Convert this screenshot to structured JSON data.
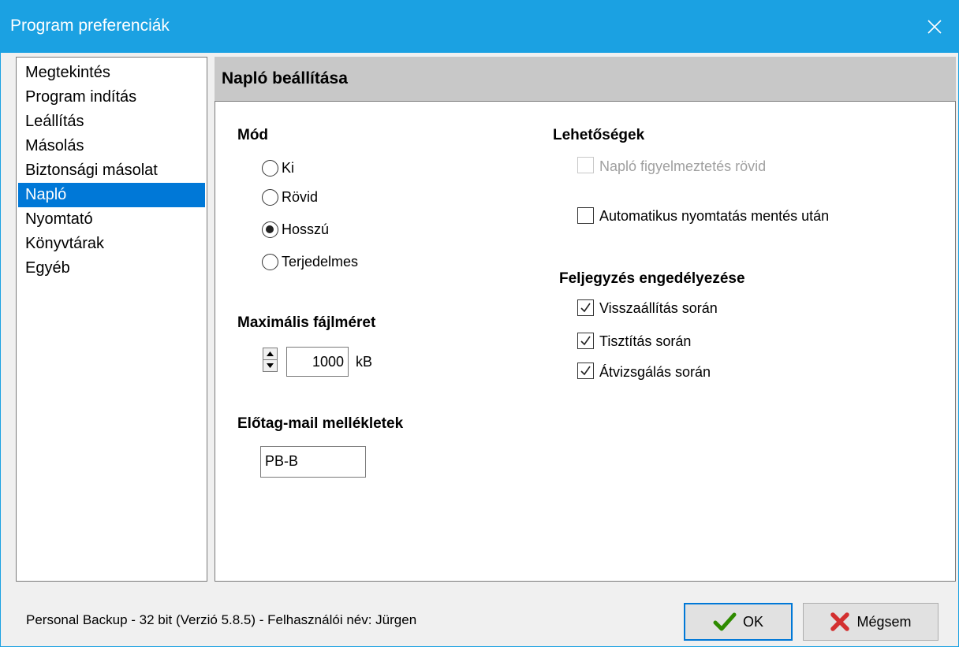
{
  "window": {
    "title": "Program preferenciák"
  },
  "nav": {
    "items": [
      {
        "label": "Megtekintés"
      },
      {
        "label": "Program indítás"
      },
      {
        "label": "Leállítás"
      },
      {
        "label": "Másolás"
      },
      {
        "label": "Biztonsági másolat"
      },
      {
        "label": "Napló"
      },
      {
        "label": "Nyomtató"
      },
      {
        "label": "Könyvtárak"
      },
      {
        "label": "Egyéb"
      }
    ],
    "selected": "Napló"
  },
  "section": {
    "title": "Napló beállítása"
  },
  "mode": {
    "title": "Mód",
    "options": [
      {
        "label": "Ki",
        "selected": false
      },
      {
        "label": "Rövid",
        "selected": false
      },
      {
        "label": "Hosszú",
        "selected": true
      },
      {
        "label": "Terjedelmes",
        "selected": false
      }
    ]
  },
  "max_size": {
    "title": "Maximális fájlméret",
    "value": "1000",
    "unit": "kB"
  },
  "prefix": {
    "title": "Előtag-mail mellékletek",
    "value": "PB-B"
  },
  "options": {
    "title": "Lehetőségek",
    "short_warning": {
      "label": "Napló figyelmeztetés rövid",
      "checked": false,
      "enabled": false
    },
    "auto_print": {
      "label": "Automatikus nyomtatás mentés után",
      "checked": false,
      "enabled": true
    }
  },
  "logging": {
    "title": "Feljegyzés engedélyezése",
    "items": [
      {
        "label": "Visszaállítás során",
        "checked": true
      },
      {
        "label": "Tisztítás során",
        "checked": true
      },
      {
        "label": "Átvizsgálás során",
        "checked": true
      }
    ]
  },
  "status": {
    "text": "Personal Backup - 32 bit (Verzió 5.8.5) - Felhasználói név: Jürgen"
  },
  "buttons": {
    "ok": "OK",
    "cancel": "Mégsem"
  },
  "colors": {
    "titlebar": "#1ba1e2",
    "selection": "#0078d7",
    "ok_icon": "#2e8b00",
    "cancel_icon": "#d32f2f"
  }
}
